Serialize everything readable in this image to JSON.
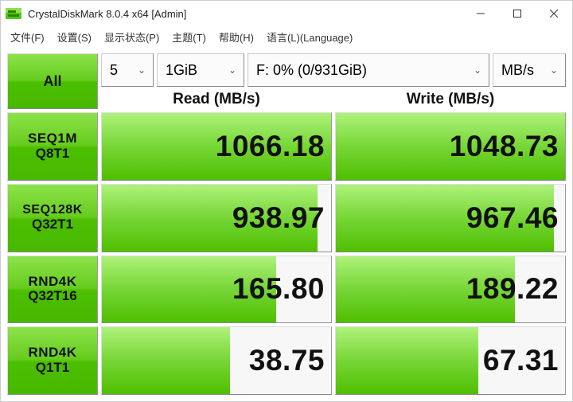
{
  "window": {
    "title": "CrystalDiskMark 8.0.4 x64 [Admin]"
  },
  "menu": [
    "文件(F)",
    "设置(S)",
    "显示状态(P)",
    "主题(T)",
    "帮助(H)",
    "语言(L)(Language)"
  ],
  "toolbar": {
    "all_label": "All",
    "count": "5",
    "size": "1GiB",
    "drive": "F: 0% (0/931GiB)",
    "unit": "MB/s"
  },
  "headers": {
    "read": "Read (MB/s)",
    "write": "Write (MB/s)"
  },
  "tests": [
    {
      "l1": "SEQ1M",
      "l2": "Q8T1",
      "read": "1066.18",
      "write": "1048.73",
      "read_pct": 100,
      "write_pct": 100
    },
    {
      "l1": "SEQ128K",
      "l2": "Q32T1",
      "read": "938.97",
      "write": "967.46",
      "read_pct": 94,
      "write_pct": 95
    },
    {
      "l1": "RND4K",
      "l2": "Q32T16",
      "read": "165.80",
      "write": "189.22",
      "read_pct": 76,
      "write_pct": 78
    },
    {
      "l1": "RND4K",
      "l2": "Q1T1",
      "read": "38.75",
      "write": "67.31",
      "read_pct": 56,
      "write_pct": 62
    }
  ]
}
